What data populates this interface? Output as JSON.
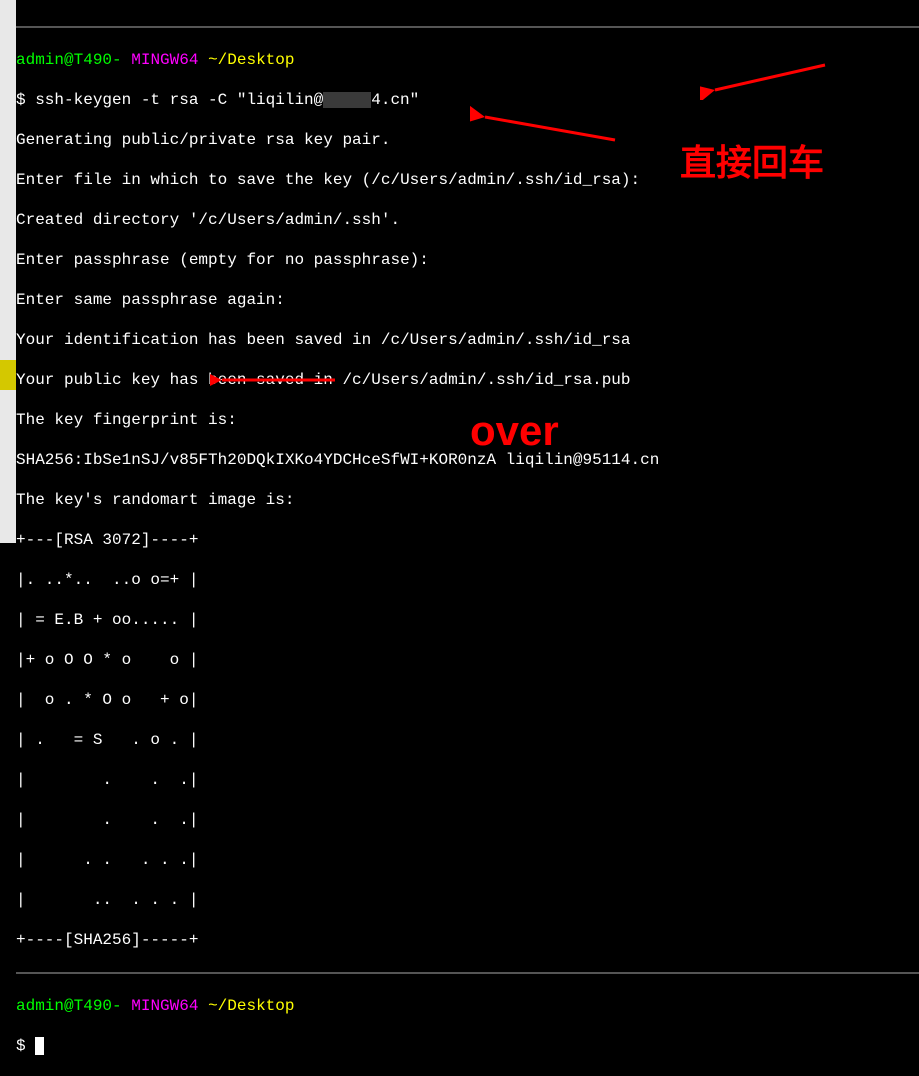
{
  "prompt1": {
    "user_host": "admin@T490-",
    "shell": "MINGW64",
    "path": "~/Desktop"
  },
  "command": {
    "prefix": "$ ",
    "cmd_pre": "ssh-keygen -t rsa -C \"liqilin@",
    "cmd_post": "4.cn\""
  },
  "output": {
    "l1": "Generating public/private rsa key pair.",
    "l2": "Enter file in which to save the key (/c/Users/admin/.ssh/id_rsa):",
    "l3": "Created directory '/c/Users/admin/.ssh'.",
    "l4": "Enter passphrase (empty for no passphrase):",
    "l5": "Enter same passphrase again:",
    "l6": "Your identification has been saved in /c/Users/admin/.ssh/id_rsa",
    "l7": "Your public key has been saved in /c/Users/admin/.ssh/id_rsa.pub",
    "l8": "The key fingerprint is:",
    "l9": "SHA256:IbSe1nSJ/v85FTh20DQkIXKo4YDCHceSfWI+KOR0nzA liqilin@95114.cn",
    "l10": "The key's randomart image is:",
    "art1": "+---[RSA 3072]----+",
    "art2": "|. ..*..  ..o o=+ |",
    "art3": "| = E.B + oo..... |",
    "art4": "|+ o O O * o    o |",
    "art5": "|  o . * O o   + o|",
    "art6": "| .   = S   . o . |",
    "art7": "|        .    .  .|",
    "art8": "|        .    .  .|",
    "art9": "|      . .   . . .|",
    "art10": "|       ..  . . . |",
    "art11": "+----[SHA256]-----+"
  },
  "prompt2": {
    "user_host": "admin@T490-",
    "shell": "MINGW64",
    "path": "~/Desktop",
    "dollar": "$ "
  },
  "annotations": {
    "label1": "直接回车",
    "label2": "over"
  },
  "colors": {
    "annotation": "#ff0000",
    "green": "#00ff00",
    "magenta": "#ff00ff",
    "yellow": "#ffff00"
  }
}
